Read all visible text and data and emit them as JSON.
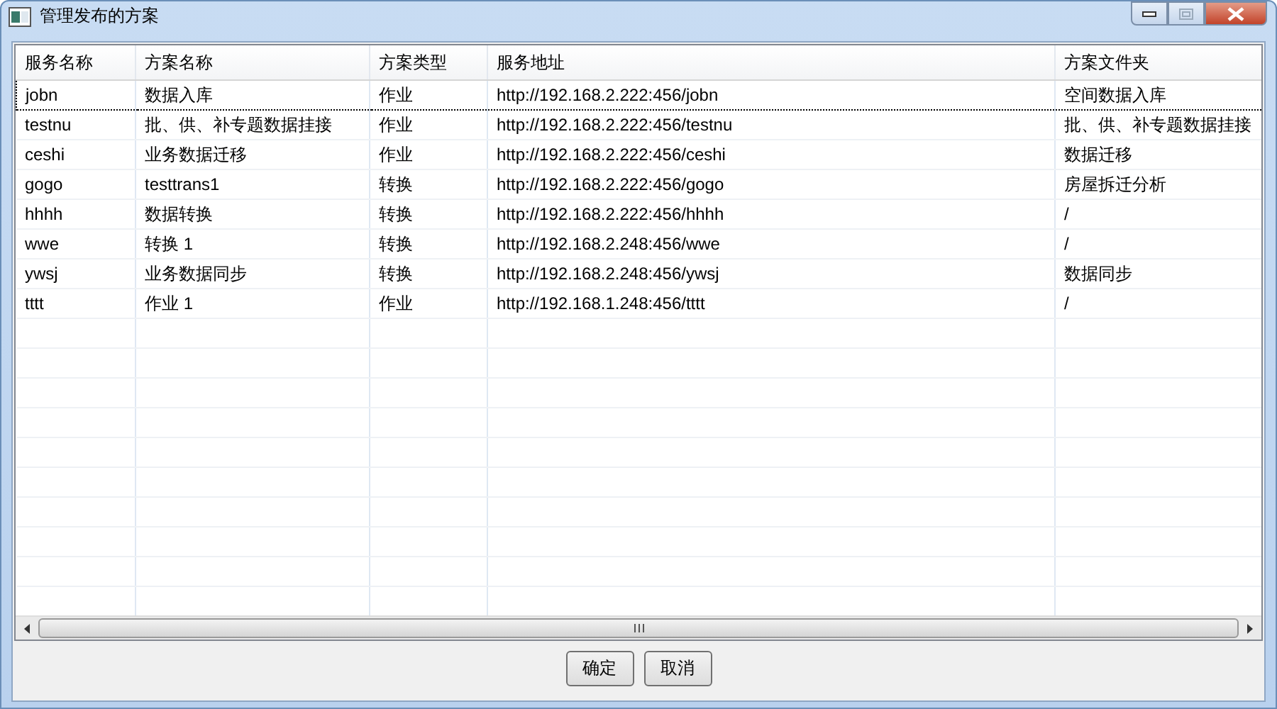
{
  "window": {
    "title": "管理发布的方案"
  },
  "table": {
    "columns": [
      "服务名称",
      "方案名称",
      "方案类型",
      "服务地址",
      "方案文件夹"
    ],
    "rows": [
      {
        "cells": [
          "jobn",
          "数据入库",
          "作业",
          "http://192.168.2.222:456/jobn",
          "空间数据入库"
        ],
        "focused": true
      },
      {
        "cells": [
          "testnu",
          "批、供、补专题数据挂接",
          "作业",
          "http://192.168.2.222:456/testnu",
          "批、供、补专题数据挂接"
        ],
        "focused": false
      },
      {
        "cells": [
          "ceshi",
          "业务数据迁移",
          "作业",
          "http://192.168.2.222:456/ceshi",
          "数据迁移"
        ],
        "focused": false
      },
      {
        "cells": [
          "gogo",
          "testtrans1",
          "转换",
          "http://192.168.2.222:456/gogo",
          "房屋拆迁分析"
        ],
        "focused": false
      },
      {
        "cells": [
          "hhhh",
          "数据转换",
          "转换",
          "http://192.168.2.222:456/hhhh",
          "/"
        ],
        "focused": false
      },
      {
        "cells": [
          "wwe",
          "转换 1",
          "转换",
          "http://192.168.2.248:456/wwe",
          "/"
        ],
        "focused": false
      },
      {
        "cells": [
          "ywsj",
          "业务数据同步",
          "转换",
          "http://192.168.2.248:456/ywsj",
          "数据同步"
        ],
        "focused": false
      },
      {
        "cells": [
          "tttt",
          "作业 1",
          "作业",
          "http://192.168.1.248:456/tttt",
          "/"
        ],
        "focused": false
      }
    ]
  },
  "buttons": [
    "确定",
    "取消"
  ]
}
